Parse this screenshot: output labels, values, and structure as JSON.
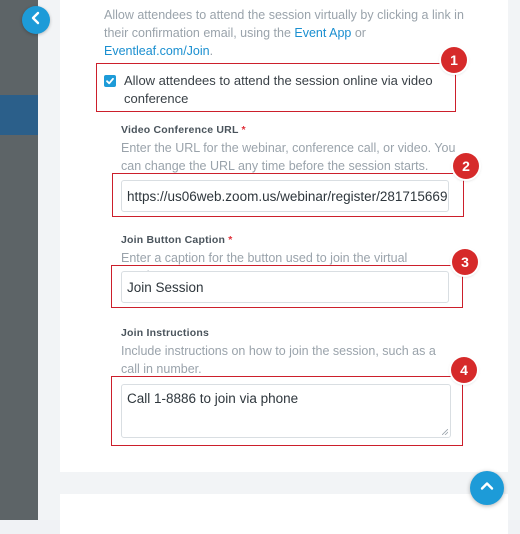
{
  "intro": {
    "text_before": "Allow attendees to attend the session virtually by clicking a link in their confirmation email, using the ",
    "link_event_app": "Event App",
    "text_middle": " or ",
    "link_eventleaf": "Eventleaf.com/Join",
    "text_end": "."
  },
  "online_checkbox": {
    "checked": true,
    "label": "Allow attendees to attend the session online via video conference"
  },
  "video_url": {
    "label": "Video Conference URL",
    "required_mark": "*",
    "help": "Enter the URL for the webinar, conference call, or video. You can change the URL any time before the session starts.",
    "value": "https://us06web.zoom.us/webinar/register/281715669"
  },
  "join_caption": {
    "label": "Join Button Caption",
    "required_mark": "*",
    "help": "Enter a caption for the button used to join the virtual session.",
    "value": "Join Session"
  },
  "join_instructions": {
    "label": "Join Instructions",
    "help": "Include instructions on how to join the session, such as a call in number.",
    "value": "Call 1-8886 to join via phone"
  },
  "callouts": [
    "1",
    "2",
    "3",
    "4"
  ],
  "icons": {
    "back": "chevron-left-icon",
    "scroll_top": "chevron-up-icon",
    "check": "check-icon"
  },
  "colors": {
    "accent": "#1d9bd8",
    "callout": "#cc1f2b",
    "badge": "#d62a2a",
    "required": "#e0303a"
  }
}
